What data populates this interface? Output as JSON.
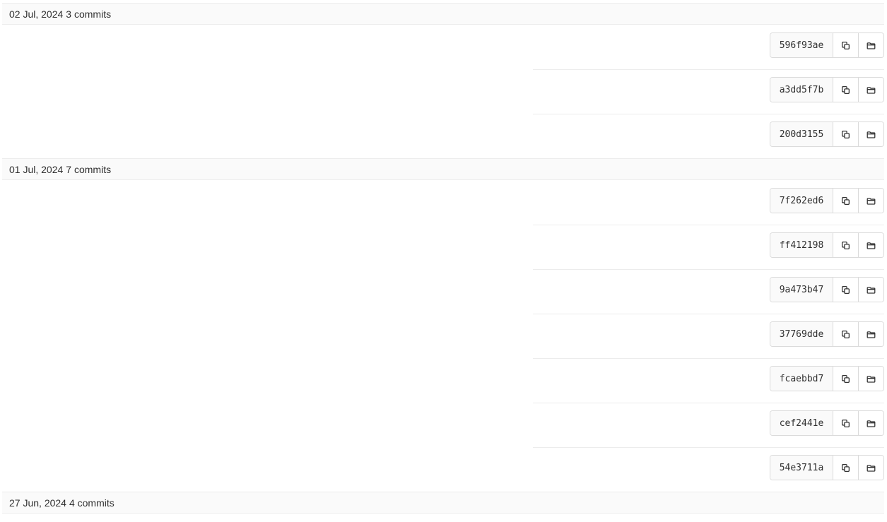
{
  "groups": [
    {
      "date": "02 Jul, 2024",
      "count": "3 commits",
      "commits": [
        "596f93ae",
        "a3dd5f7b",
        "200d3155"
      ]
    },
    {
      "date": "01 Jul, 2024",
      "count": "7 commits",
      "commits": [
        "7f262ed6",
        "ff412198",
        "9a473b47",
        "37769dde",
        "fcaebbd7",
        "cef2441e",
        "54e3711a"
      ]
    },
    {
      "date": "27 Jun, 2024",
      "count": "4 commits",
      "commits": []
    }
  ],
  "icons": {
    "copy": "copy-icon",
    "browse": "folder-open-icon"
  },
  "colors": {
    "header_bg": "#fafafa",
    "border": "#dbdbdb",
    "text": "#303030"
  }
}
